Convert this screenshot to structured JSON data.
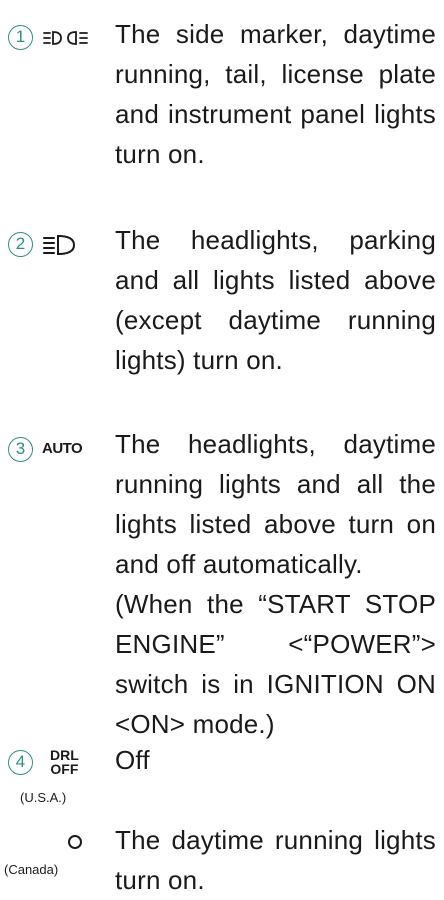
{
  "items": [
    {
      "number": "1",
      "icon_name": "side-marker-lights-icon",
      "text": "The side marker, daytime running, tail, license plate and instrument panel lights turn on."
    },
    {
      "number": "2",
      "icon_name": "headlights-icon",
      "text": "The headlights, parking and all lights listed above (except daytime running lights) turn on."
    },
    {
      "number": "3",
      "icon_label": "AUTO",
      "text": "The headlights, daytime running lights and all the lights listed above turn on and off automatically.",
      "note": "(When the “START STOP ENGINE” <“POWER”> switch is in IGNITION ON <ON> mode.)"
    },
    {
      "number": "4",
      "icon_label_top": "DRL",
      "icon_label_bottom": "OFF",
      "region": "(U.S.A.)",
      "text": "Off"
    },
    {
      "icon_name": "o-position-icon",
      "region": "(Canada)",
      "text": "The daytime running lights turn on."
    }
  ],
  "colors": {
    "accent": "#2f8f83",
    "text": "#1a1a1a"
  }
}
